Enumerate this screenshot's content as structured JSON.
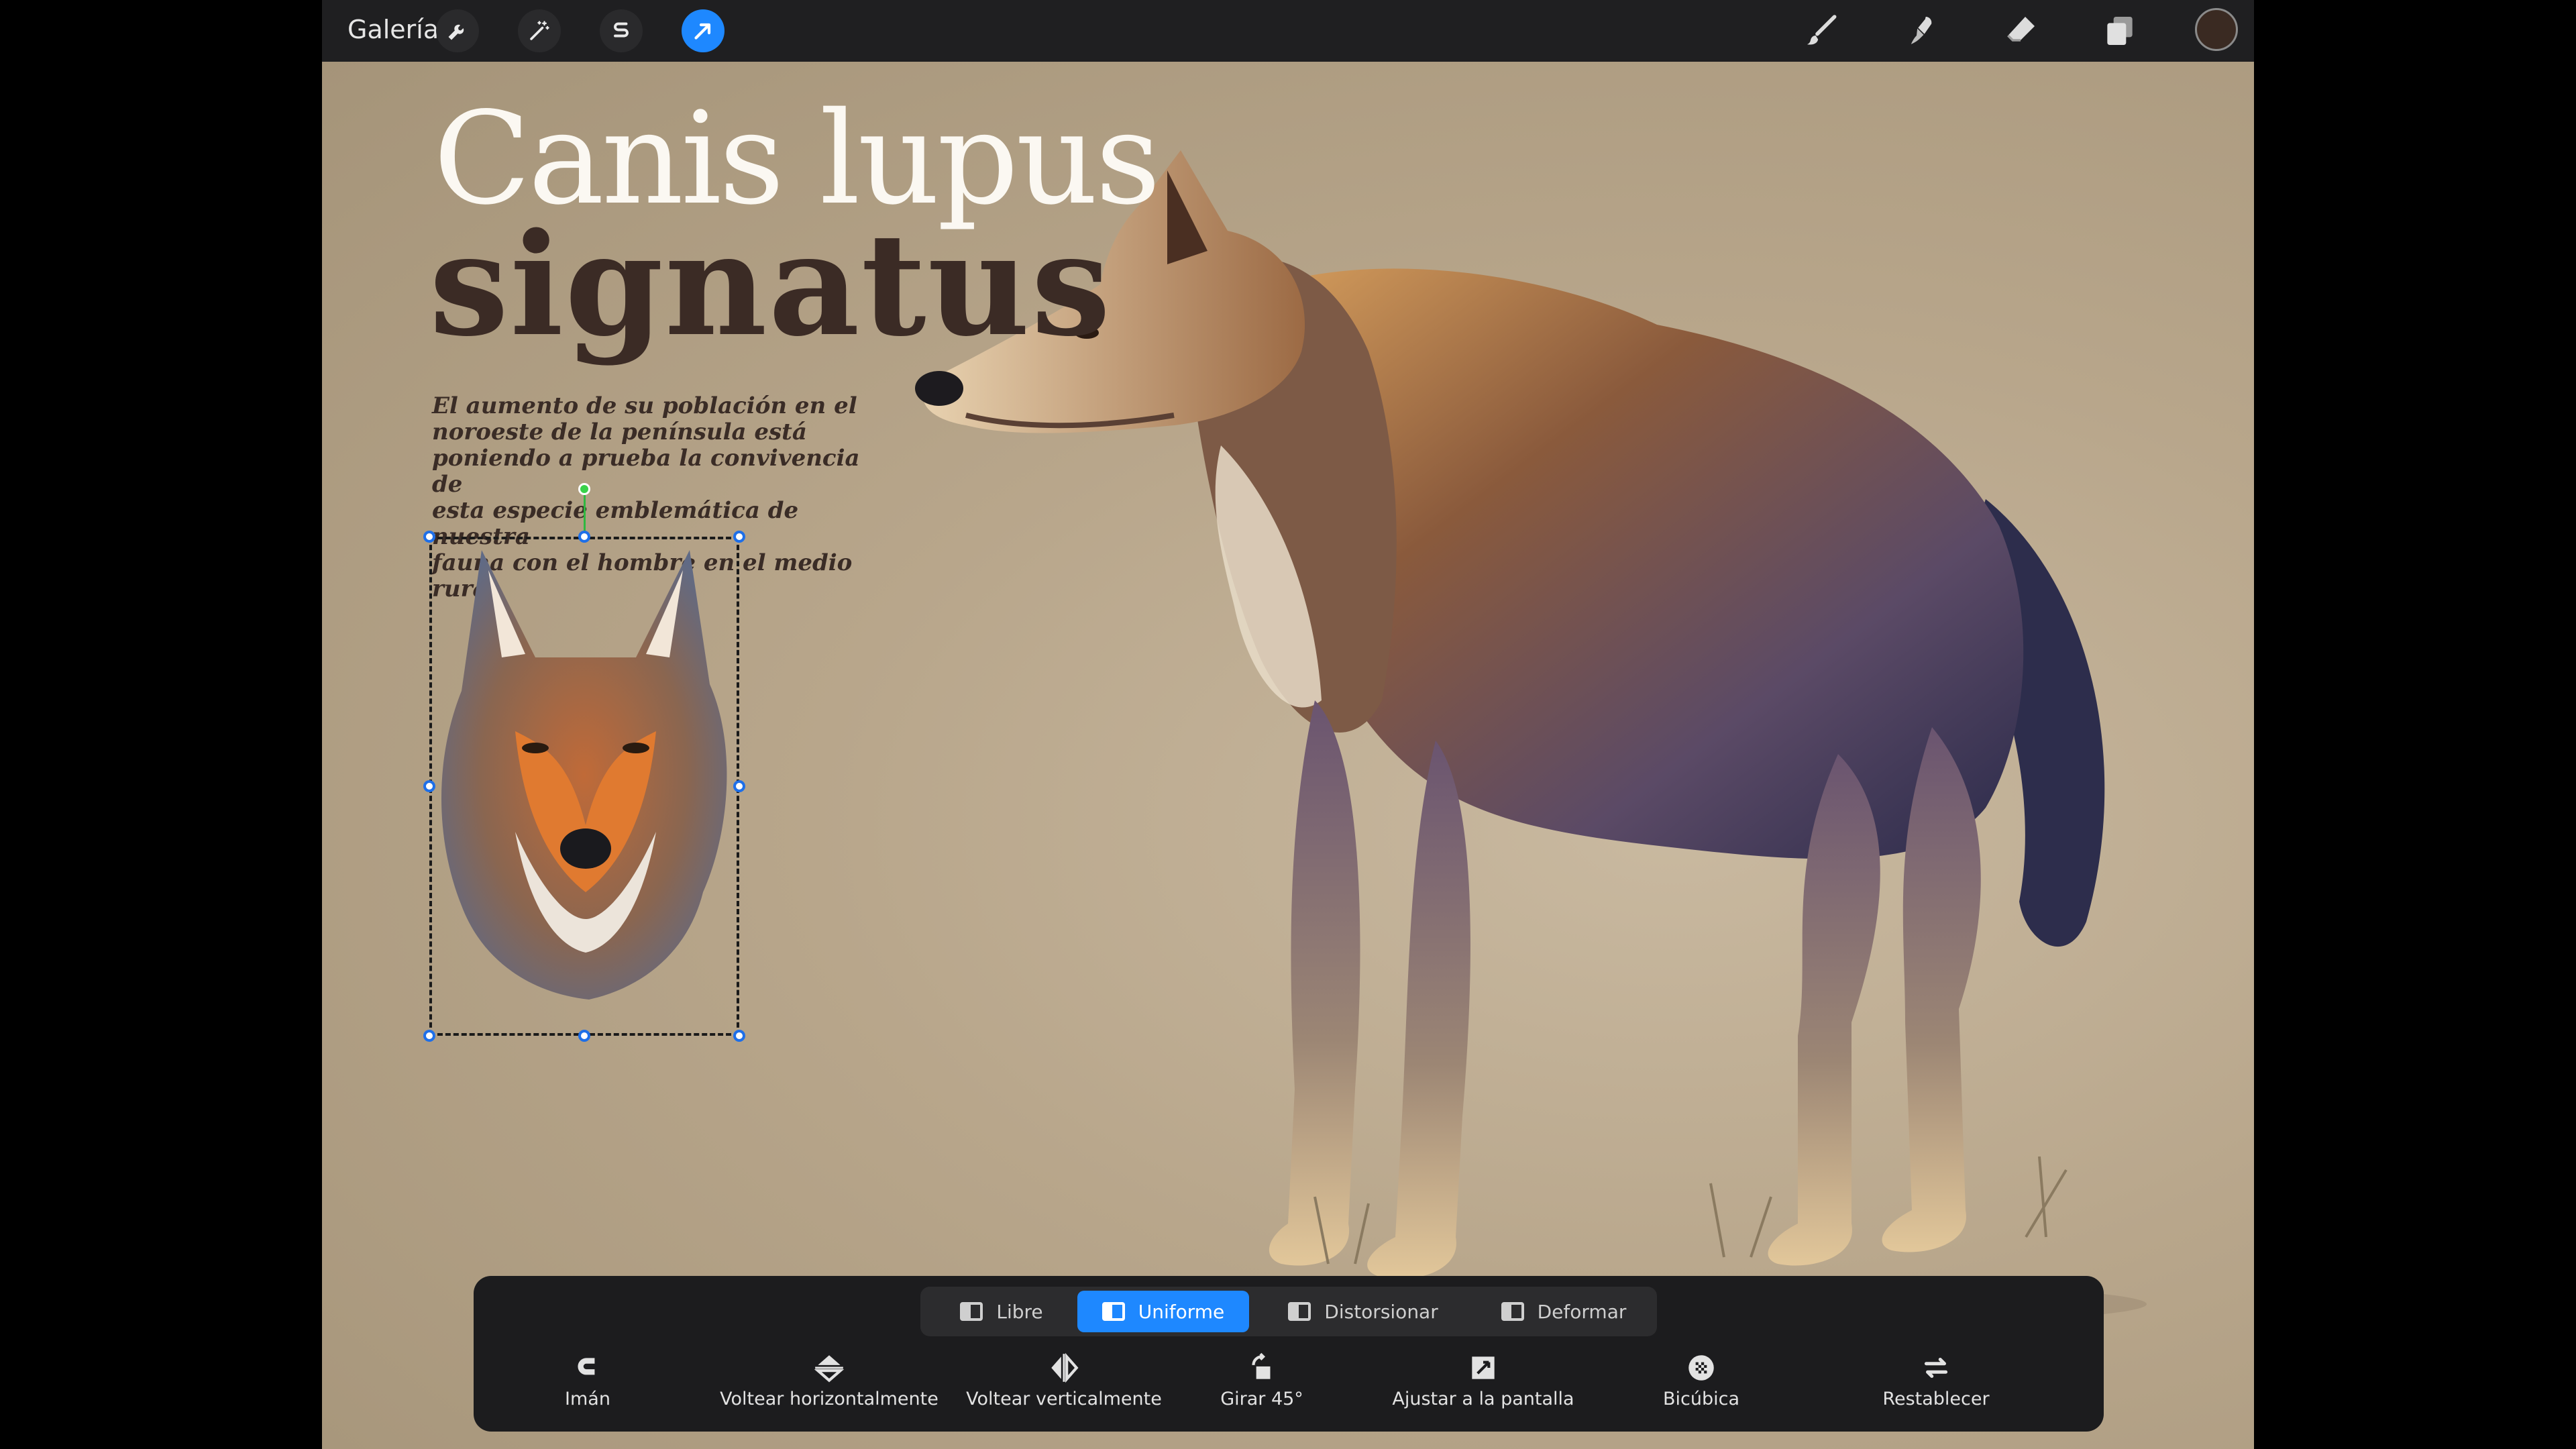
{
  "topbar": {
    "gallery_label": "Galería",
    "left_icons": [
      "wrench-icon",
      "magic-wand-icon",
      "selection-s-icon",
      "transform-arrow-icon"
    ],
    "right_tools": [
      "brush-icon",
      "smudge-icon",
      "eraser-icon",
      "layers-icon"
    ],
    "current_color": "#3a2a22",
    "accent": "#1e88ff"
  },
  "artwork": {
    "title_line1": "Canis lupus",
    "title_line2": "signatus",
    "paragraph_lines": [
      "El aumento de su población en el",
      "noroeste de la península está",
      "poniendo a prueba la convivencia de",
      "esta especie emblemática de nuestra",
      "fauna con el hombre en el medio rural"
    ]
  },
  "transform": {
    "modes": [
      {
        "label": "Libre",
        "active": false
      },
      {
        "label": "Uniforme",
        "active": true
      },
      {
        "label": "Distorsionar",
        "active": false
      },
      {
        "label": "Deformar",
        "active": false
      }
    ],
    "actions": [
      {
        "label": "Imán",
        "icon": "magnet-icon"
      },
      {
        "label": "Voltear horizontalmente",
        "icon": "flip-horizontal-icon"
      },
      {
        "label": "Voltear verticalmente",
        "icon": "flip-vertical-icon"
      },
      {
        "label": "Girar 45°",
        "icon": "rotate-icon"
      },
      {
        "label": "Ajustar a la pantalla",
        "icon": "fit-screen-icon"
      },
      {
        "label": "Bicúbica",
        "icon": "interpolation-icon"
      },
      {
        "label": "Restablecer",
        "icon": "reset-icon"
      }
    ]
  }
}
